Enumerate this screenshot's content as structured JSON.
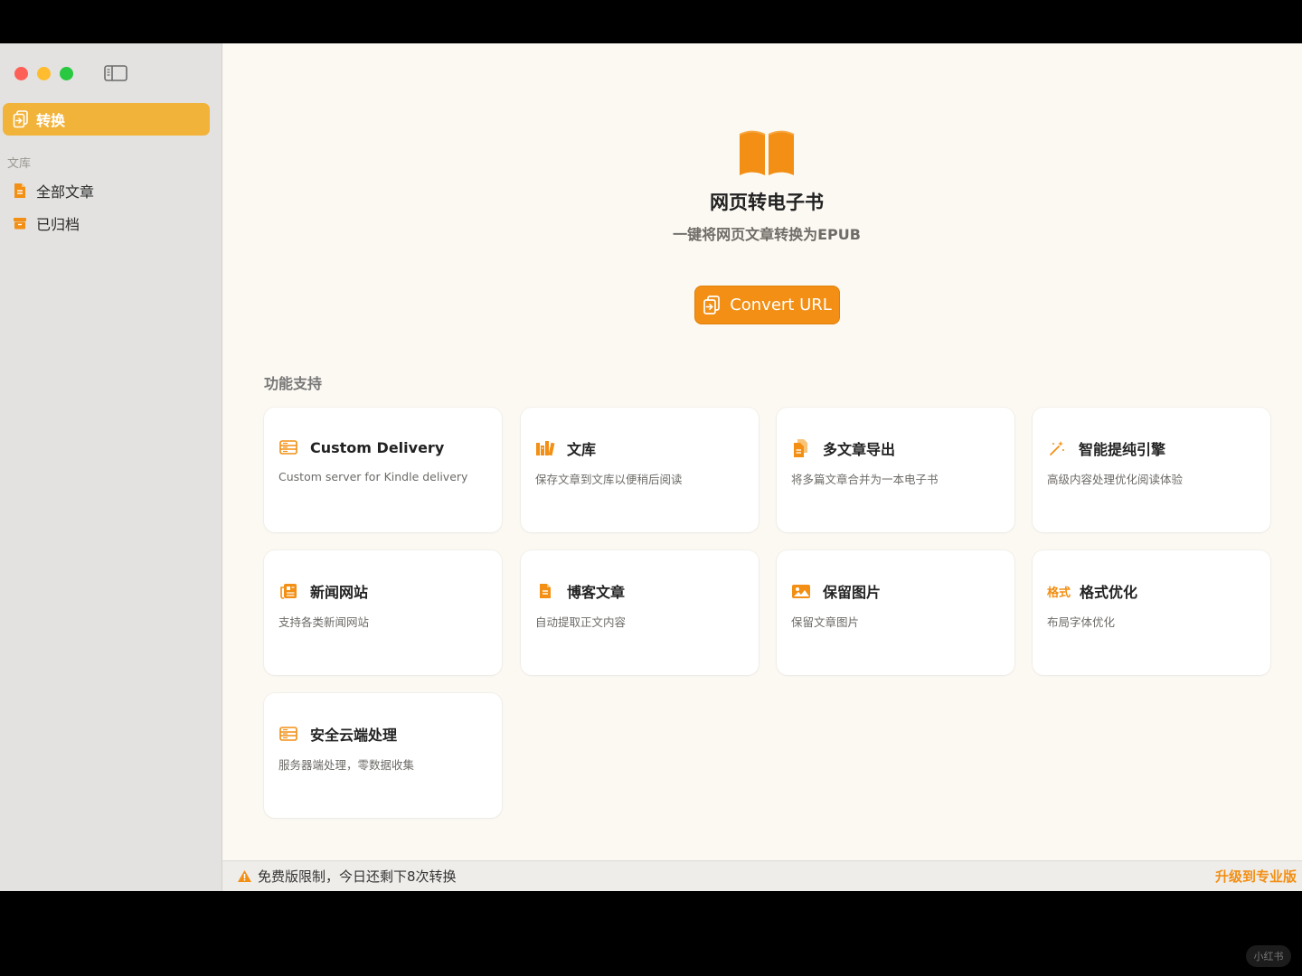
{
  "sidebar": {
    "active_item": {
      "label": "转换",
      "icon": "convert-doc-icon"
    },
    "section_label": "文库",
    "items": [
      {
        "label": "全部文章",
        "icon": "document-icon"
      },
      {
        "label": "已归档",
        "icon": "archive-box-icon"
      }
    ]
  },
  "hero": {
    "title": "网页转电子书",
    "subtitle": "一键将网页文章转换为EPUB",
    "button_label": "Convert URL"
  },
  "features": {
    "label": "功能支持",
    "cards": [
      {
        "title": "Custom Delivery",
        "desc": "Custom server for Kindle delivery",
        "icon": "server-icon"
      },
      {
        "title": "文库",
        "desc": "保存文章到文库以便稍后阅读",
        "icon": "books-icon"
      },
      {
        "title": "多文章导出",
        "desc": "将多篇文章合并为一本电子书",
        "icon": "documents-icon"
      },
      {
        "title": "智能提纯引擎",
        "desc": "高级内容处理优化阅读体验",
        "icon": "magic-wand-icon"
      },
      {
        "title": "新闻网站",
        "desc": "支持各类新闻网站",
        "icon": "newspaper-icon"
      },
      {
        "title": "博客文章",
        "desc": "自动提取正文内容",
        "icon": "document-icon"
      },
      {
        "title": "保留图片",
        "desc": "保留文章图片",
        "icon": "photo-icon"
      },
      {
        "title": "格式优化",
        "desc": "布局字体优化",
        "icon": "format-text-icon",
        "icon_text": "格式"
      },
      {
        "title": "安全云端处理",
        "desc": "服务器端处理，零数据收集",
        "icon": "server-icon"
      }
    ]
  },
  "status": {
    "message": "免费版限制，今日还剩下8次转换",
    "upgrade_label": "升级到专业版"
  },
  "watermark": "小红书",
  "colors": {
    "accent": "#f28f14",
    "sidebar_active": "#f2b33b",
    "background": "#fcf9f3"
  }
}
